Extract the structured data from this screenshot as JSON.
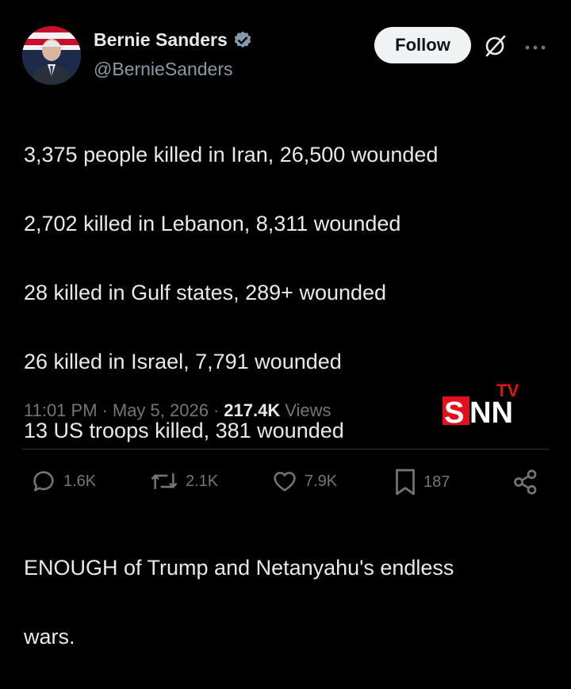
{
  "author": {
    "display_name": "Bernie Sanders",
    "handle": "@BernieSanders",
    "verified": true,
    "verified_badge_color": "#829aab"
  },
  "header": {
    "follow_label": "Follow",
    "grok_icon": "grok-icon",
    "more_icon": "more-options-icon"
  },
  "tweet": {
    "lines": [
      "3,375 people killed in Iran, 26,500 wounded",
      "2,702 killed in Lebanon, 8,311 wounded",
      "28 killed in Gulf states, 289+ wounded",
      "26 killed in Israel, 7,791 wounded",
      "13 US troops killed, 381 wounded",
      "",
      "ENOUGH of Trump and Netanyahu's endless",
      "wars."
    ]
  },
  "meta": {
    "time": "11:01 PM",
    "sep1": "·",
    "date": "May 5, 2026",
    "sep2": "·",
    "views_count": "217.4K",
    "views_label": "Views"
  },
  "watermark": {
    "main": "SNN",
    "sub": "TV",
    "colors": {
      "red": "#e3101c",
      "white": "#ffffff"
    }
  },
  "actions": {
    "replies": "1.6K",
    "reposts": "2.1K",
    "likes": "7.9K",
    "bookmarks": "187"
  },
  "colors": {
    "background": "#000000",
    "text": "#e7e9ea",
    "muted": "#71767b",
    "follow_bg": "#eff3f4"
  }
}
